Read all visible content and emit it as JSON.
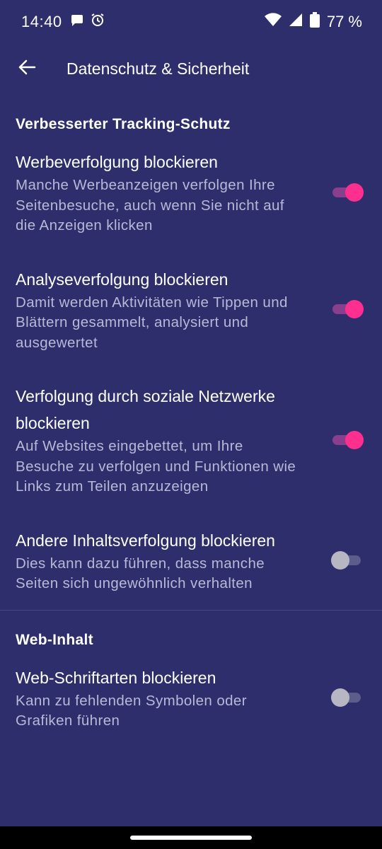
{
  "status_bar": {
    "time": "14:40",
    "icons_left": [
      "message-icon",
      "alarm-icon"
    ],
    "icons_right": [
      "wifi-icon",
      "signal-icon",
      "battery-icon"
    ],
    "battery": "77 %"
  },
  "app_bar": {
    "back_icon": "arrow-left-icon",
    "title": "Datenschutz & Sicherheit"
  },
  "sections": [
    {
      "header": "Verbesserter Tracking-Schutz",
      "items": [
        {
          "title": "Werbeverfolgung blockieren",
          "description": "Manche Werbeanzeigen verfolgen Ihre Seitenbesuche, auch wenn Sie nicht auf die Anzeigen klicken",
          "enabled": true
        },
        {
          "title": "Analyseverfolgung blockieren",
          "description": "Damit werden Aktivitäten wie Tippen und Blättern gesammelt, analysiert und ausgewertet",
          "enabled": true
        },
        {
          "title": "Verfolgung durch soziale Netzwerke blockieren",
          "description": "Auf Websites eingebettet, um Ihre Besuche zu verfolgen und Funktionen wie Links zum Teilen anzuzeigen",
          "enabled": true
        },
        {
          "title": "Andere Inhaltsverfolgung blockieren",
          "description": "Dies kann dazu führen, dass manche Seiten sich ungewöhnlich verhalten",
          "enabled": false
        }
      ]
    },
    {
      "header": "Web-Inhalt",
      "items": [
        {
          "title": "Web-Schriftarten blockieren",
          "description": "Kann zu fehlenden Symbolen oder Grafiken führen",
          "enabled": false
        }
      ]
    }
  ],
  "colors": {
    "background": "#2d2e6b",
    "toggle_on": "#ff2f8f",
    "toggle_off": "#b7b7c3",
    "secondary_text": "#b8b9d6"
  }
}
